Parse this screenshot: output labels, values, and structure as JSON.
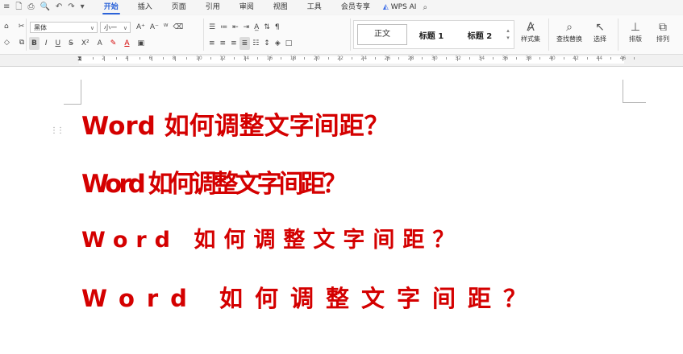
{
  "quick_access": [
    "🗋",
    "⎙",
    "🔍",
    "↶",
    "↷"
  ],
  "menu_tabs": [
    "开始",
    "插入",
    "页面",
    "引用",
    "审阅",
    "视图",
    "工具",
    "会员专享"
  ],
  "wps_ai": "WPS AI",
  "font_name": "黑体",
  "font_size": "小一",
  "styles": [
    "正文",
    "标题 1",
    "标题 2"
  ],
  "big_buttons": {
    "style_set": "样式集",
    "find_replace": "查找替换",
    "select": "选择",
    "layout": "排版",
    "sort": "排列"
  },
  "ruler_numbers": [
    "2",
    "4",
    "6",
    "8",
    "10",
    "12",
    "14",
    "16",
    "18",
    "20",
    "22",
    "24",
    "26",
    "28",
    "30",
    "32",
    "34",
    "36",
    "38",
    "40",
    "42",
    "44",
    "46"
  ],
  "document_lines": [
    "Word 如何调整文字间距？",
    "Word 如何调整文字间距？",
    "Word 如何调整文字间距？",
    "Word 如何调整文字间距？"
  ],
  "accent_color": "#2b63d9",
  "text_color": "#d40000"
}
